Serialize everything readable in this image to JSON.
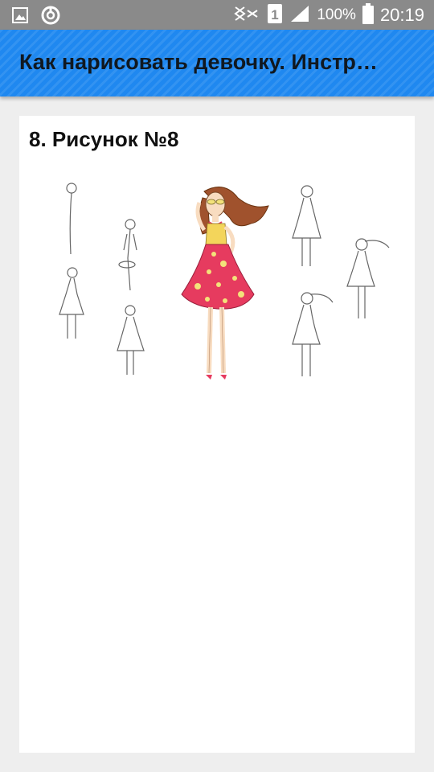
{
  "status_bar": {
    "sim_slot": "1",
    "battery_percent": "100%",
    "time": "20:19",
    "icons": [
      "gallery-icon",
      "sync-icon",
      "mute-icon",
      "sim-icon",
      "signal-icon",
      "battery-icon"
    ]
  },
  "app_bar": {
    "title": "Как нарисовать девочку. Инстр…",
    "color": "#1f88f0"
  },
  "content": {
    "step_title": "8. Рисунок №8",
    "dress_color": "#e63b5f",
    "hair_color": "#a0522d"
  }
}
